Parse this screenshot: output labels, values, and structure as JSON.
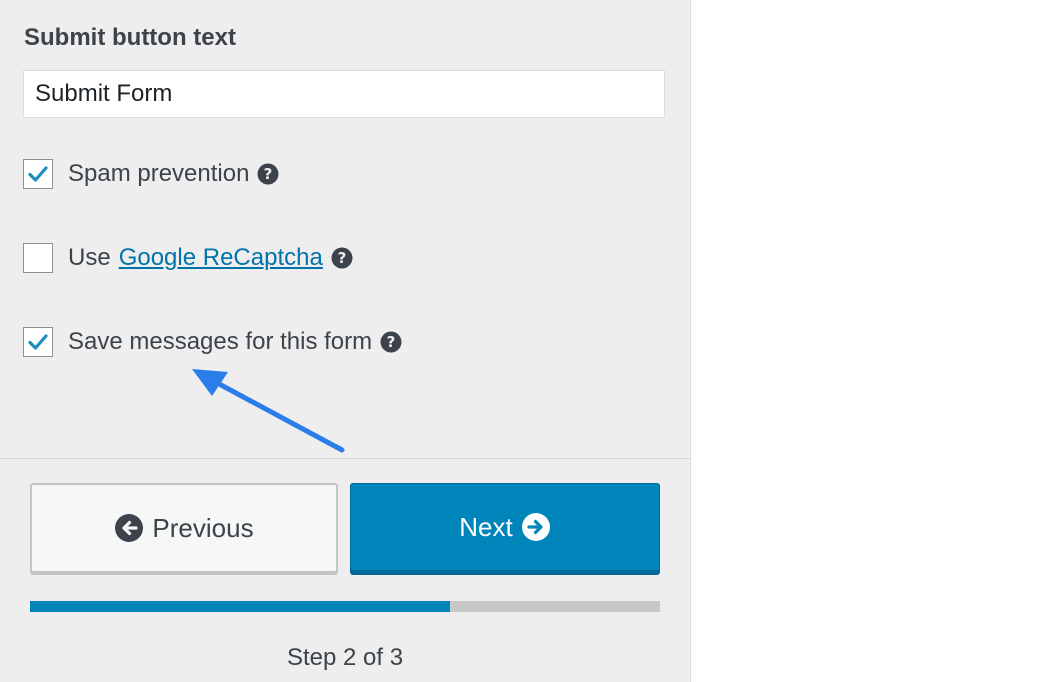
{
  "form": {
    "submit_label": "Submit button text",
    "submit_value": "Submit Form",
    "options": [
      {
        "prefix": "Spam prevention",
        "link": "",
        "checked": true,
        "icon": "help-circle-icon"
      },
      {
        "prefix": "Use",
        "link": "Google ReCaptcha",
        "checked": false,
        "icon": "help-circle-icon"
      },
      {
        "prefix": "Save messages for this form",
        "link": "",
        "checked": true,
        "icon": "help-circle-icon"
      }
    ]
  },
  "nav": {
    "previous_label": "Previous",
    "previous_icon": "arrow-left-circle-icon",
    "next_label": "Next",
    "next_icon": "arrow-right-circle-icon"
  },
  "progress": {
    "fraction": 0.667,
    "step_text": "Step 2 of 3"
  },
  "colors": {
    "accent": "#0085ba",
    "link": "#0073aa",
    "annotation_arrow": "#2b7de9",
    "panel_bg": "#eeeeee"
  }
}
